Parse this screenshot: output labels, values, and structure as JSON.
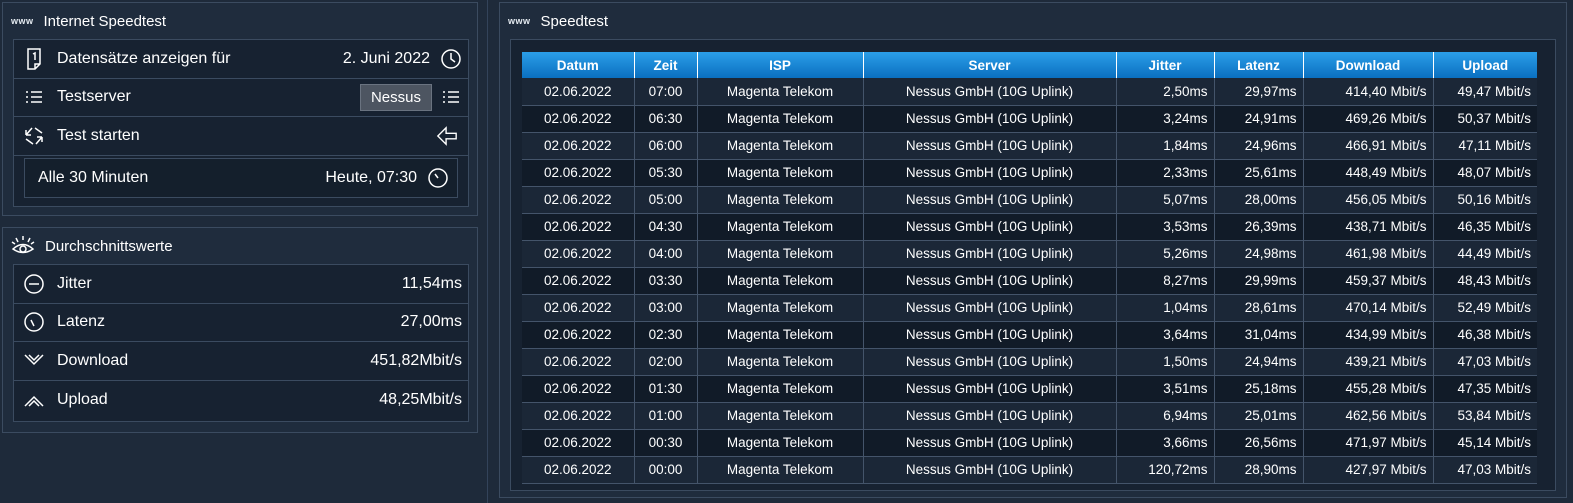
{
  "speedtest_panel": {
    "www": "www",
    "title": "Internet Speedtest",
    "records_label": "Datensätze anzeigen für",
    "records_date": "2. Juni 2022",
    "server_label": "Testserver",
    "server_value": "Nessus",
    "start_label": "Test starten",
    "interval_label": "Alle 30 Minuten",
    "next_run": "Heute, 07:30"
  },
  "averages_panel": {
    "title": "Durchschnittswerte",
    "items": [
      {
        "label": "Jitter",
        "value": "11,54ms",
        "icon": "minus-circle-icon"
      },
      {
        "label": "Latenz",
        "value": "27,00ms",
        "icon": "gauge-icon"
      },
      {
        "label": "Download",
        "value": "451,82Mbit/s",
        "icon": "chevron-down-icon"
      },
      {
        "label": "Upload",
        "value": "48,25Mbit/s",
        "icon": "chevron-up-icon"
      }
    ]
  },
  "table_panel": {
    "www": "www",
    "title": "Speedtest",
    "columns": [
      "Datum",
      "Zeit",
      "ISP",
      "Server",
      "Jitter",
      "Latenz",
      "Download",
      "Upload"
    ],
    "rows": [
      [
        "02.06.2022",
        "07:00",
        "Magenta Telekom",
        "Nessus GmbH (10G Uplink)",
        "2,50ms",
        "29,97ms",
        "414,40 Mbit/s",
        "49,47 Mbit/s"
      ],
      [
        "02.06.2022",
        "06:30",
        "Magenta Telekom",
        "Nessus GmbH (10G Uplink)",
        "3,24ms",
        "24,91ms",
        "469,26 Mbit/s",
        "50,37 Mbit/s"
      ],
      [
        "02.06.2022",
        "06:00",
        "Magenta Telekom",
        "Nessus GmbH (10G Uplink)",
        "1,84ms",
        "24,96ms",
        "466,91 Mbit/s",
        "47,11 Mbit/s"
      ],
      [
        "02.06.2022",
        "05:30",
        "Magenta Telekom",
        "Nessus GmbH (10G Uplink)",
        "2,33ms",
        "25,61ms",
        "448,49 Mbit/s",
        "48,07 Mbit/s"
      ],
      [
        "02.06.2022",
        "05:00",
        "Magenta Telekom",
        "Nessus GmbH (10G Uplink)",
        "5,07ms",
        "28,00ms",
        "456,05 Mbit/s",
        "50,16 Mbit/s"
      ],
      [
        "02.06.2022",
        "04:30",
        "Magenta Telekom",
        "Nessus GmbH (10G Uplink)",
        "3,53ms",
        "26,39ms",
        "438,71 Mbit/s",
        "46,35 Mbit/s"
      ],
      [
        "02.06.2022",
        "04:00",
        "Magenta Telekom",
        "Nessus GmbH (10G Uplink)",
        "5,26ms",
        "24,98ms",
        "461,98 Mbit/s",
        "44,49 Mbit/s"
      ],
      [
        "02.06.2022",
        "03:30",
        "Magenta Telekom",
        "Nessus GmbH (10G Uplink)",
        "8,27ms",
        "29,99ms",
        "459,37 Mbit/s",
        "48,43 Mbit/s"
      ],
      [
        "02.06.2022",
        "03:00",
        "Magenta Telekom",
        "Nessus GmbH (10G Uplink)",
        "1,04ms",
        "28,61ms",
        "470,14 Mbit/s",
        "52,49 Mbit/s"
      ],
      [
        "02.06.2022",
        "02:30",
        "Magenta Telekom",
        "Nessus GmbH (10G Uplink)",
        "3,64ms",
        "31,04ms",
        "434,99 Mbit/s",
        "46,38 Mbit/s"
      ],
      [
        "02.06.2022",
        "02:00",
        "Magenta Telekom",
        "Nessus GmbH (10G Uplink)",
        "1,50ms",
        "24,94ms",
        "439,21 Mbit/s",
        "47,03 Mbit/s"
      ],
      [
        "02.06.2022",
        "01:30",
        "Magenta Telekom",
        "Nessus GmbH (10G Uplink)",
        "3,51ms",
        "25,18ms",
        "455,28 Mbit/s",
        "47,35 Mbit/s"
      ],
      [
        "02.06.2022",
        "01:00",
        "Magenta Telekom",
        "Nessus GmbH (10G Uplink)",
        "6,94ms",
        "25,01ms",
        "462,56 Mbit/s",
        "53,84 Mbit/s"
      ],
      [
        "02.06.2022",
        "00:30",
        "Magenta Telekom",
        "Nessus GmbH (10G Uplink)",
        "3,66ms",
        "26,56ms",
        "471,97 Mbit/s",
        "45,14 Mbit/s"
      ],
      [
        "02.06.2022",
        "00:00",
        "Magenta Telekom",
        "Nessus GmbH (10G Uplink)",
        "120,72ms",
        "28,90ms",
        "427,97 Mbit/s",
        "47,03 Mbit/s"
      ]
    ]
  },
  "colors": {
    "background": "#1e2a3a",
    "header_blue": "#1a86d6",
    "panel": "#1f2c3d"
  }
}
